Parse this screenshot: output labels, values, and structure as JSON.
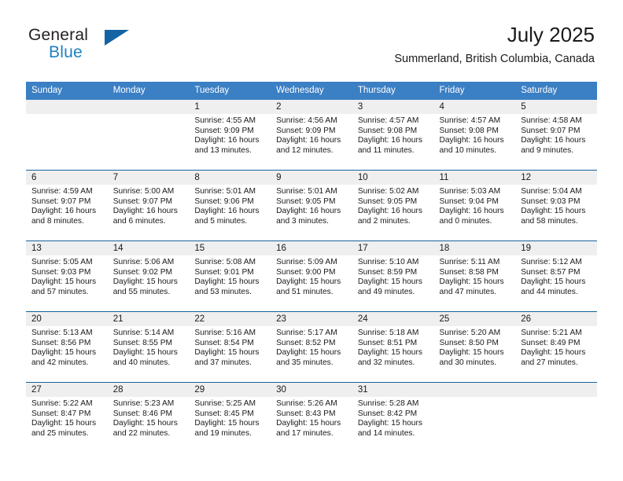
{
  "brand": {
    "name_part1": "General",
    "name_part2": "Blue",
    "accent_color": "#1464a5",
    "blue_text_color": "#1f7fc4"
  },
  "header": {
    "title": "July 2025",
    "location": "Summerland, British Columbia, Canada"
  },
  "calendar": {
    "header_bg": "#3b7fc4",
    "week_divider_color": "#15639e",
    "daynum_band_bg": "#efefef",
    "weekday_headers": [
      "Sunday",
      "Monday",
      "Tuesday",
      "Wednesday",
      "Thursday",
      "Friday",
      "Saturday"
    ],
    "weeks": [
      [
        {
          "day": "",
          "sunrise": "",
          "sunset": "",
          "daylight1": "",
          "daylight2": "",
          "empty": true
        },
        {
          "day": "",
          "sunrise": "",
          "sunset": "",
          "daylight1": "",
          "daylight2": "",
          "empty": true
        },
        {
          "day": "1",
          "sunrise": "Sunrise: 4:55 AM",
          "sunset": "Sunset: 9:09 PM",
          "daylight1": "Daylight: 16 hours",
          "daylight2": "and 13 minutes."
        },
        {
          "day": "2",
          "sunrise": "Sunrise: 4:56 AM",
          "sunset": "Sunset: 9:09 PM",
          "daylight1": "Daylight: 16 hours",
          "daylight2": "and 12 minutes."
        },
        {
          "day": "3",
          "sunrise": "Sunrise: 4:57 AM",
          "sunset": "Sunset: 9:08 PM",
          "daylight1": "Daylight: 16 hours",
          "daylight2": "and 11 minutes."
        },
        {
          "day": "4",
          "sunrise": "Sunrise: 4:57 AM",
          "sunset": "Sunset: 9:08 PM",
          "daylight1": "Daylight: 16 hours",
          "daylight2": "and 10 minutes."
        },
        {
          "day": "5",
          "sunrise": "Sunrise: 4:58 AM",
          "sunset": "Sunset: 9:07 PM",
          "daylight1": "Daylight: 16 hours",
          "daylight2": "and 9 minutes."
        }
      ],
      [
        {
          "day": "6",
          "sunrise": "Sunrise: 4:59 AM",
          "sunset": "Sunset: 9:07 PM",
          "daylight1": "Daylight: 16 hours",
          "daylight2": "and 8 minutes."
        },
        {
          "day": "7",
          "sunrise": "Sunrise: 5:00 AM",
          "sunset": "Sunset: 9:07 PM",
          "daylight1": "Daylight: 16 hours",
          "daylight2": "and 6 minutes."
        },
        {
          "day": "8",
          "sunrise": "Sunrise: 5:01 AM",
          "sunset": "Sunset: 9:06 PM",
          "daylight1": "Daylight: 16 hours",
          "daylight2": "and 5 minutes."
        },
        {
          "day": "9",
          "sunrise": "Sunrise: 5:01 AM",
          "sunset": "Sunset: 9:05 PM",
          "daylight1": "Daylight: 16 hours",
          "daylight2": "and 3 minutes."
        },
        {
          "day": "10",
          "sunrise": "Sunrise: 5:02 AM",
          "sunset": "Sunset: 9:05 PM",
          "daylight1": "Daylight: 16 hours",
          "daylight2": "and 2 minutes."
        },
        {
          "day": "11",
          "sunrise": "Sunrise: 5:03 AM",
          "sunset": "Sunset: 9:04 PM",
          "daylight1": "Daylight: 16 hours",
          "daylight2": "and 0 minutes."
        },
        {
          "day": "12",
          "sunrise": "Sunrise: 5:04 AM",
          "sunset": "Sunset: 9:03 PM",
          "daylight1": "Daylight: 15 hours",
          "daylight2": "and 58 minutes."
        }
      ],
      [
        {
          "day": "13",
          "sunrise": "Sunrise: 5:05 AM",
          "sunset": "Sunset: 9:03 PM",
          "daylight1": "Daylight: 15 hours",
          "daylight2": "and 57 minutes."
        },
        {
          "day": "14",
          "sunrise": "Sunrise: 5:06 AM",
          "sunset": "Sunset: 9:02 PM",
          "daylight1": "Daylight: 15 hours",
          "daylight2": "and 55 minutes."
        },
        {
          "day": "15",
          "sunrise": "Sunrise: 5:08 AM",
          "sunset": "Sunset: 9:01 PM",
          "daylight1": "Daylight: 15 hours",
          "daylight2": "and 53 minutes."
        },
        {
          "day": "16",
          "sunrise": "Sunrise: 5:09 AM",
          "sunset": "Sunset: 9:00 PM",
          "daylight1": "Daylight: 15 hours",
          "daylight2": "and 51 minutes."
        },
        {
          "day": "17",
          "sunrise": "Sunrise: 5:10 AM",
          "sunset": "Sunset: 8:59 PM",
          "daylight1": "Daylight: 15 hours",
          "daylight2": "and 49 minutes."
        },
        {
          "day": "18",
          "sunrise": "Sunrise: 5:11 AM",
          "sunset": "Sunset: 8:58 PM",
          "daylight1": "Daylight: 15 hours",
          "daylight2": "and 47 minutes."
        },
        {
          "day": "19",
          "sunrise": "Sunrise: 5:12 AM",
          "sunset": "Sunset: 8:57 PM",
          "daylight1": "Daylight: 15 hours",
          "daylight2": "and 44 minutes."
        }
      ],
      [
        {
          "day": "20",
          "sunrise": "Sunrise: 5:13 AM",
          "sunset": "Sunset: 8:56 PM",
          "daylight1": "Daylight: 15 hours",
          "daylight2": "and 42 minutes."
        },
        {
          "day": "21",
          "sunrise": "Sunrise: 5:14 AM",
          "sunset": "Sunset: 8:55 PM",
          "daylight1": "Daylight: 15 hours",
          "daylight2": "and 40 minutes."
        },
        {
          "day": "22",
          "sunrise": "Sunrise: 5:16 AM",
          "sunset": "Sunset: 8:54 PM",
          "daylight1": "Daylight: 15 hours",
          "daylight2": "and 37 minutes."
        },
        {
          "day": "23",
          "sunrise": "Sunrise: 5:17 AM",
          "sunset": "Sunset: 8:52 PM",
          "daylight1": "Daylight: 15 hours",
          "daylight2": "and 35 minutes."
        },
        {
          "day": "24",
          "sunrise": "Sunrise: 5:18 AM",
          "sunset": "Sunset: 8:51 PM",
          "daylight1": "Daylight: 15 hours",
          "daylight2": "and 32 minutes."
        },
        {
          "day": "25",
          "sunrise": "Sunrise: 5:20 AM",
          "sunset": "Sunset: 8:50 PM",
          "daylight1": "Daylight: 15 hours",
          "daylight2": "and 30 minutes."
        },
        {
          "day": "26",
          "sunrise": "Sunrise: 5:21 AM",
          "sunset": "Sunset: 8:49 PM",
          "daylight1": "Daylight: 15 hours",
          "daylight2": "and 27 minutes."
        }
      ],
      [
        {
          "day": "27",
          "sunrise": "Sunrise: 5:22 AM",
          "sunset": "Sunset: 8:47 PM",
          "daylight1": "Daylight: 15 hours",
          "daylight2": "and 25 minutes."
        },
        {
          "day": "28",
          "sunrise": "Sunrise: 5:23 AM",
          "sunset": "Sunset: 8:46 PM",
          "daylight1": "Daylight: 15 hours",
          "daylight2": "and 22 minutes."
        },
        {
          "day": "29",
          "sunrise": "Sunrise: 5:25 AM",
          "sunset": "Sunset: 8:45 PM",
          "daylight1": "Daylight: 15 hours",
          "daylight2": "and 19 minutes."
        },
        {
          "day": "30",
          "sunrise": "Sunrise: 5:26 AM",
          "sunset": "Sunset: 8:43 PM",
          "daylight1": "Daylight: 15 hours",
          "daylight2": "and 17 minutes."
        },
        {
          "day": "31",
          "sunrise": "Sunrise: 5:28 AM",
          "sunset": "Sunset: 8:42 PM",
          "daylight1": "Daylight: 15 hours",
          "daylight2": "and 14 minutes."
        },
        {
          "day": "",
          "sunrise": "",
          "sunset": "",
          "daylight1": "",
          "daylight2": "",
          "empty": true
        },
        {
          "day": "",
          "sunrise": "",
          "sunset": "",
          "daylight1": "",
          "daylight2": "",
          "empty": true
        }
      ]
    ]
  }
}
